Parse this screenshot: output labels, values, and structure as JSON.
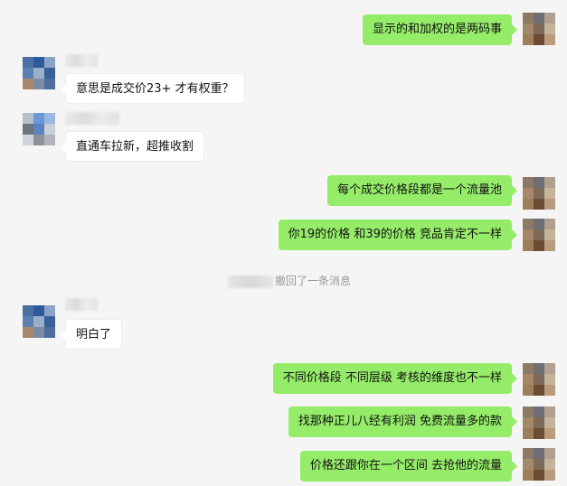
{
  "messages": [
    {
      "side": "out",
      "text": "显示的和加权的是两码事"
    },
    {
      "side": "in",
      "text": "意思是成交价23+  才有权重？"
    },
    {
      "side": "in",
      "text": "直通车拉新，超推收割"
    },
    {
      "side": "out",
      "text": "每个成交价格段都是一个流量池"
    },
    {
      "side": "out",
      "text": "你19的价格  和39的价格  竞品肯定不一样"
    },
    {
      "side": "in",
      "text": "明白了"
    },
    {
      "side": "out",
      "text": "不同价格段  不同层级  考核的维度也不一样"
    },
    {
      "side": "out",
      "text": "找那种正儿八经有利润  免费流量多的款"
    },
    {
      "side": "out",
      "text": "价格还跟你在一个区间  去抢他的流量"
    }
  ],
  "system_notice": "撤回了一条消息",
  "colors": {
    "background": "#f5f5f5",
    "outgoing_bubble": "#95ec69",
    "incoming_bubble": "#ffffff",
    "system_text": "#9a9a9a"
  }
}
